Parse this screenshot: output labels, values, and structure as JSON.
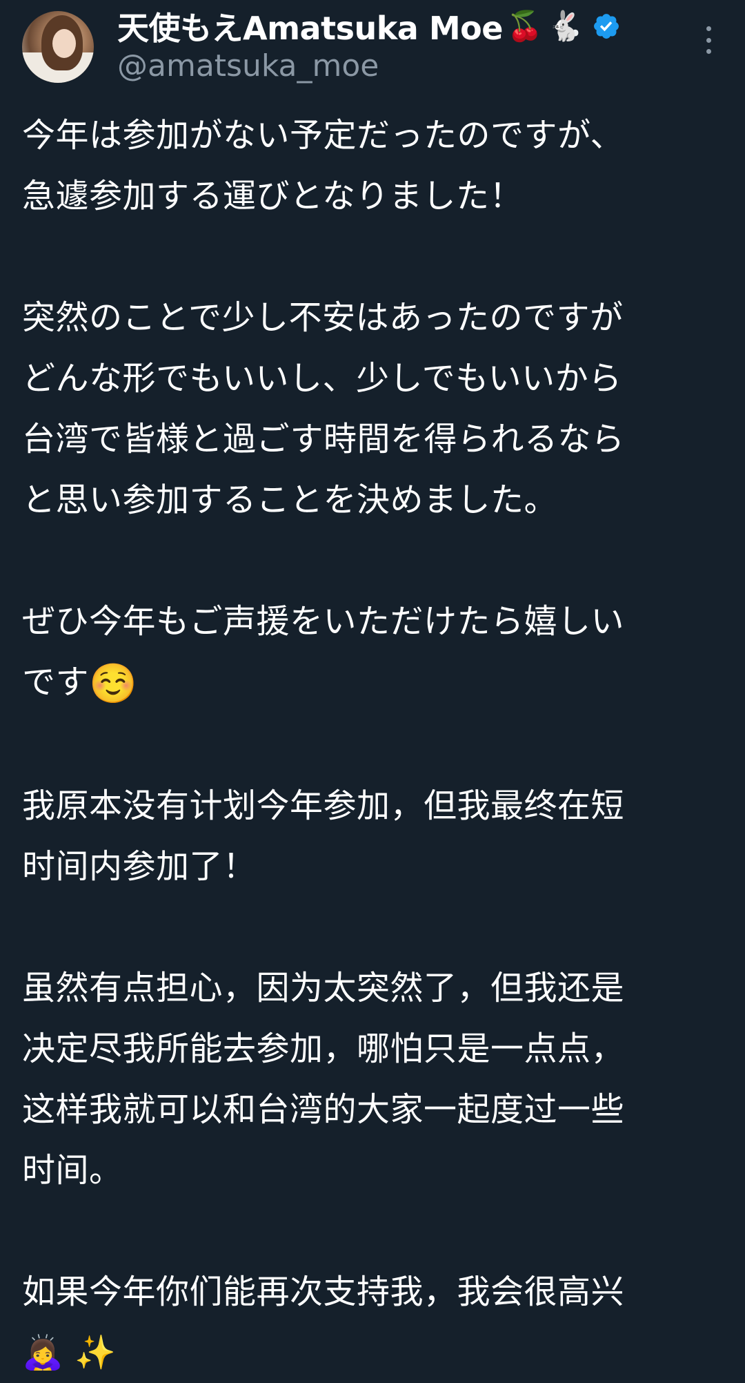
{
  "author": {
    "display_name": "天使もえAmatsuka Moe",
    "name_emojis": [
      "🍒",
      "🐇"
    ],
    "handle": "@amatsuka_moe",
    "verified": true,
    "verified_color": "#1d9bf0"
  },
  "tweet": {
    "paragraphs": [
      {
        "lines": [
          "今年は参加がない予定だったのですが、",
          "急遽参加する運びとなりました！"
        ]
      },
      {
        "lines": [
          "突然のことで少し不安はあったのですが",
          "どんな形でもいいし、少しでもいいから",
          "台湾で皆様と過ごす時間を得られるなら",
          "と思い参加することを決めました。"
        ]
      },
      {
        "lines": [
          "ぜひ今年もご声援をいただけたら嬉しい",
          "です"
        ],
        "trailing_emoji": "☺️"
      },
      {
        "lines": [
          "我原本没有计划今年参加，但我最终在短",
          "时间内参加了！"
        ]
      },
      {
        "lines": [
          "虽然有点担心，因为太突然了，但我还是",
          "决定尽我所能去参加，哪怕只是一点点，",
          "这样我就可以和台湾的大家一起度过一些",
          "时间。"
        ]
      },
      {
        "lines": [
          "如果今年你们能再次支持我，我会很高兴"
        ]
      },
      {
        "lines": [
          "🙇‍♀️ ✨"
        ]
      }
    ]
  },
  "colors": {
    "background": "#15202b",
    "text_primary": "#ffffff",
    "text_secondary": "#8b98a5"
  }
}
